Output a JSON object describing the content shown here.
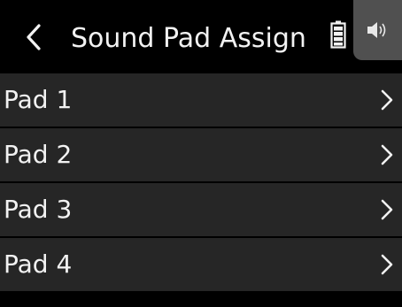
{
  "header": {
    "title": "Sound Pad Assign",
    "back_icon": "chevron-left-icon",
    "battery_icon": "battery-icon",
    "speaker_icon": "speaker-icon"
  },
  "list": {
    "items": [
      {
        "label": "Pad 1",
        "icon": "chevron-right-icon"
      },
      {
        "label": "Pad 2",
        "icon": "chevron-right-icon"
      },
      {
        "label": "Pad 3",
        "icon": "chevron-right-icon"
      },
      {
        "label": "Pad 4",
        "icon": "chevron-right-icon"
      }
    ]
  },
  "colors": {
    "background": "#000000",
    "row": "#262626",
    "text": "#f2f2f2",
    "speaker_tab": "#505050"
  }
}
